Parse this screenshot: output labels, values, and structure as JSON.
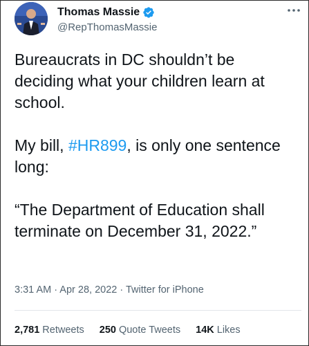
{
  "author": {
    "display_name": "Thomas Massie",
    "handle": "@RepThomasMassie",
    "verified": true
  },
  "tweet": {
    "line1": "Bureaucrats in DC shouldn’t be deciding what your children learn at school.",
    "line2_prefix": "My bill, ",
    "hashtag": "#HR899",
    "line2_suffix": ", is only one sentence long:",
    "line3": "“The Department of Education shall terminate on December 31, 2022.”"
  },
  "meta": {
    "time": "3:31 AM",
    "sep1": " · ",
    "date": "Apr 28, 2022",
    "sep2": " · ",
    "source": "Twitter for iPhone"
  },
  "stats": {
    "retweets_count": "2,781",
    "retweets_label": "Retweets",
    "quotes_count": "250",
    "quotes_label": "Quote Tweets",
    "likes_count": "14K",
    "likes_label": "Likes"
  },
  "colors": {
    "accent": "#1d9bf0",
    "text": "#0f1419",
    "secondary": "#536471"
  },
  "icons": {
    "verified": "verified-badge-icon",
    "more": "more-options-icon"
  }
}
